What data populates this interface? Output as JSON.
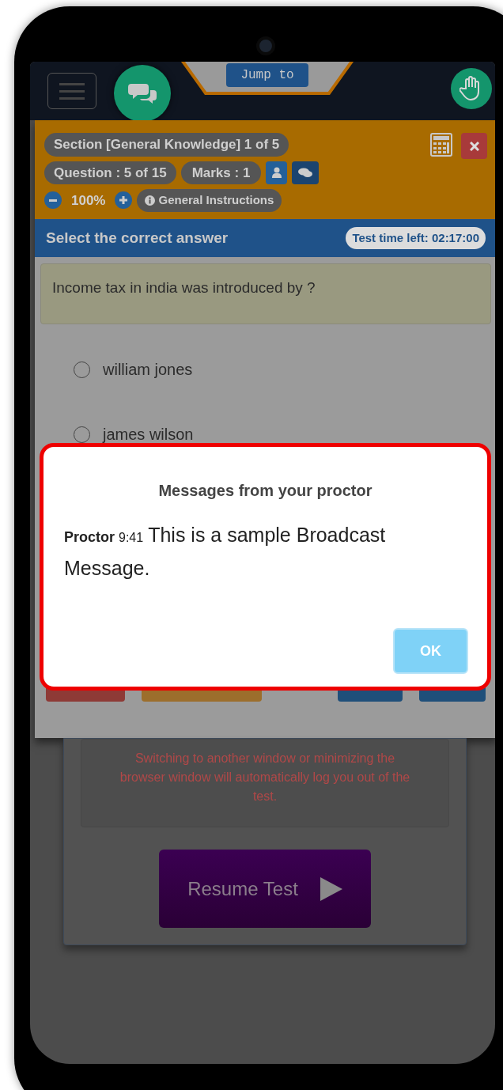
{
  "top_bar": {
    "jump_button": "Jump to"
  },
  "header": {
    "section": "Section [General Knowledge] 1 of 5",
    "question": "Question : 5 of 15",
    "marks": "Marks : 1",
    "zoom": "100%",
    "instructions": "General Instructions"
  },
  "answer_bar": {
    "title": "Select the correct answer",
    "timer": "Test time left: 02:17:00"
  },
  "question": "Income tax in india was introduced by ?",
  "options": [
    {
      "label": "william jones",
      "selected": false
    },
    {
      "label": "james wilson",
      "selected": false
    }
  ],
  "warning": "Switching to another window or minimizing the browser window will automatically log you out of the test.",
  "resume_button": "Resume Test",
  "dialog": {
    "title": "Messages from your proctor",
    "messages": [
      {
        "sender": "Proctor",
        "time": "9:41",
        "text": "This is a sample Broadcast Message."
      }
    ],
    "ok_button": "OK"
  }
}
